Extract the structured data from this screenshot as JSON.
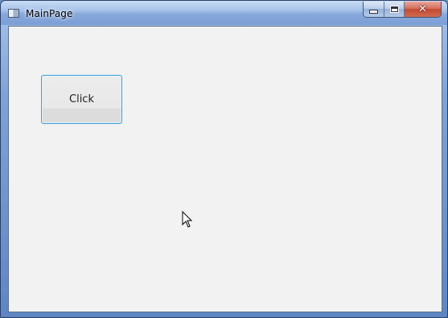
{
  "window": {
    "title": "MainPage"
  },
  "caption_buttons": {
    "minimize_icon": "minimize-icon",
    "maximize_icon": "maximize-icon",
    "close_icon": "close-icon",
    "close_glyph": "✕"
  },
  "main": {
    "button_label": "Click"
  },
  "colors": {
    "button_border": "#3c9fd9",
    "close_button": "#c24a32",
    "client_background": "#f2f2f2"
  }
}
